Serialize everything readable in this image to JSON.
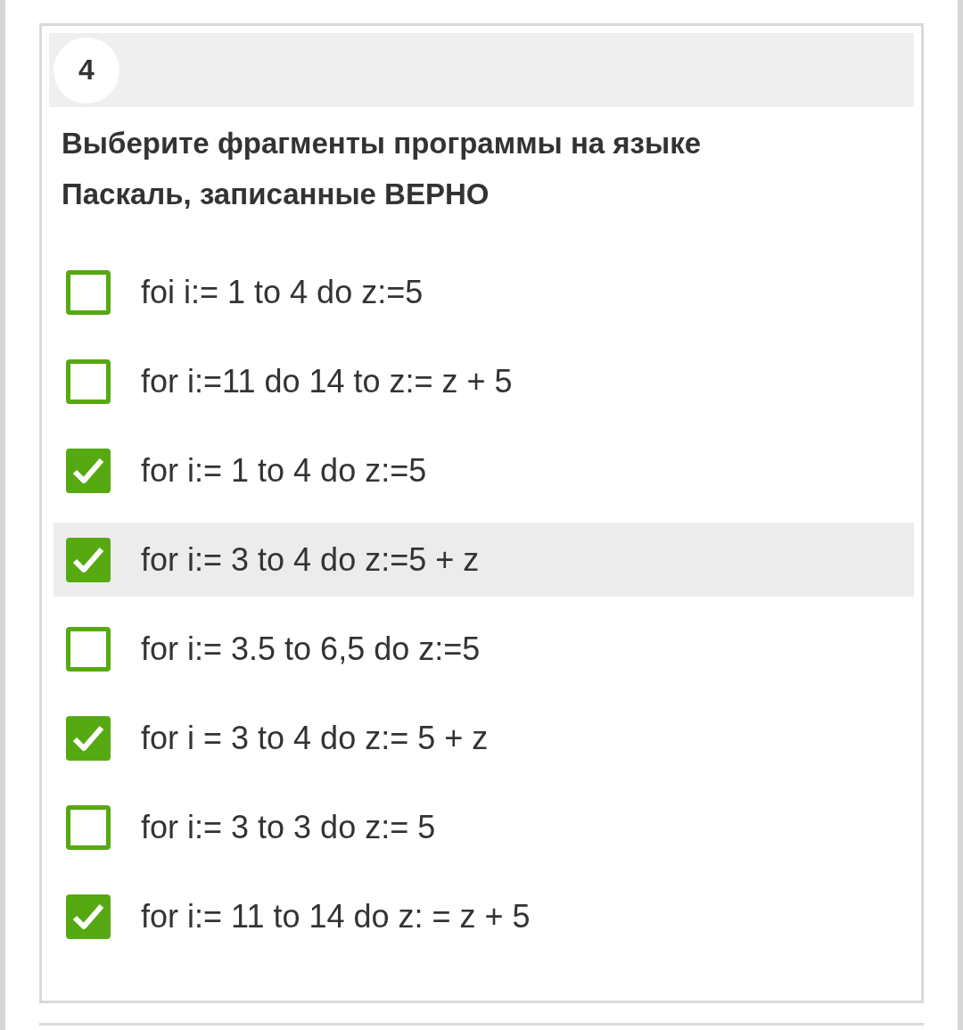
{
  "question": {
    "number": "4",
    "text": "Выберите фрагменты программы на языке Паскаль, записанные ВЕРНО",
    "options": [
      {
        "label": "foi i:= 1 to 4 do z:=5",
        "checked": false,
        "highlighted": false
      },
      {
        "label": "for i:=11 do 14 to z:= z + 5",
        "checked": false,
        "highlighted": false
      },
      {
        "label": "for i:= 1 to 4 do z:=5",
        "checked": true,
        "highlighted": false
      },
      {
        "label": "for i:= 3 to 4 do z:=5 + z",
        "checked": true,
        "highlighted": true
      },
      {
        "label": "for i:= 3.5 to 6,5 do z:=5",
        "checked": false,
        "highlighted": false
      },
      {
        "label": "for i = 3 to 4 do z:= 5 + z",
        "checked": true,
        "highlighted": false
      },
      {
        "label": "for i:= 3 to 3 do z:= 5",
        "checked": false,
        "highlighted": false
      },
      {
        "label": "for i:= 11 to 14 do z: = z + 5",
        "checked": true,
        "highlighted": false
      }
    ]
  }
}
